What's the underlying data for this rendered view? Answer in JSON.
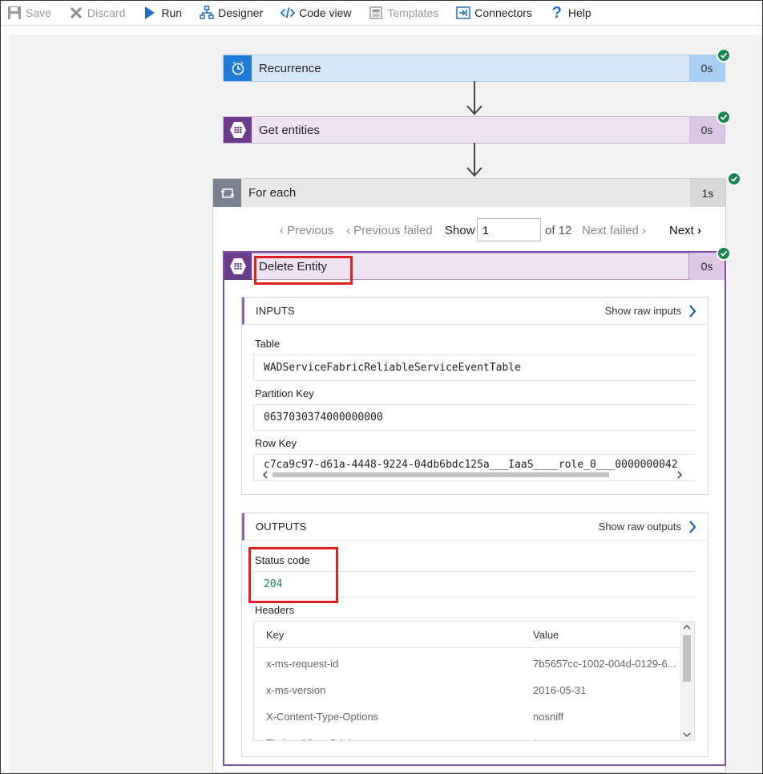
{
  "toolbar": {
    "save": "Save",
    "discard": "Discard",
    "run": "Run",
    "designer": "Designer",
    "code_view": "Code view",
    "templates": "Templates",
    "connectors": "Connectors",
    "help": "Help"
  },
  "steps": {
    "recurrence": {
      "title": "Recurrence",
      "duration": "0s"
    },
    "get_entities": {
      "title": "Get entities",
      "duration": "0s"
    },
    "for_each": {
      "title": "For each",
      "duration": "1s"
    }
  },
  "pager": {
    "previous": "Previous",
    "previous_failed": "Previous failed",
    "show": "Show",
    "current": "1",
    "of_total": "of 12",
    "next_failed": "Next failed",
    "next": "Next"
  },
  "delete_entity": {
    "title": "Delete Entity",
    "duration": "0s",
    "inputs": {
      "header": "INPUTS",
      "show_raw": "Show raw inputs",
      "table_label": "Table",
      "table_value": "WADServiceFabricReliableServiceEventTable",
      "partition_label": "Partition Key",
      "partition_value": "0637030374000000000",
      "rowkey_label": "Row Key",
      "rowkey_value": "c7ca9c97-d61a-4448-9224-04db6bdc125a___IaaS____role_0___0000000042"
    },
    "outputs": {
      "header": "OUTPUTS",
      "show_raw": "Show raw outputs",
      "status_label": "Status code",
      "status_value": "204",
      "headers_label": "Headers",
      "table_columns": [
        "Key",
        "Value"
      ],
      "rows": [
        {
          "key": "x-ms-request-id",
          "value": "7b5657cc-1002-004d-0129-6..."
        },
        {
          "key": "x-ms-version",
          "value": "2016-05-31"
        },
        {
          "key": "X-Content-Type-Options",
          "value": "nosniff"
        },
        {
          "key": "Timing-Allow-Origin",
          "value": "*"
        }
      ]
    }
  },
  "colors": {
    "recurrence_accent": "#1f7ad8",
    "storage_accent": "#6a3c8c",
    "success_green": "#18864b",
    "highlight_red": "#e02020"
  }
}
